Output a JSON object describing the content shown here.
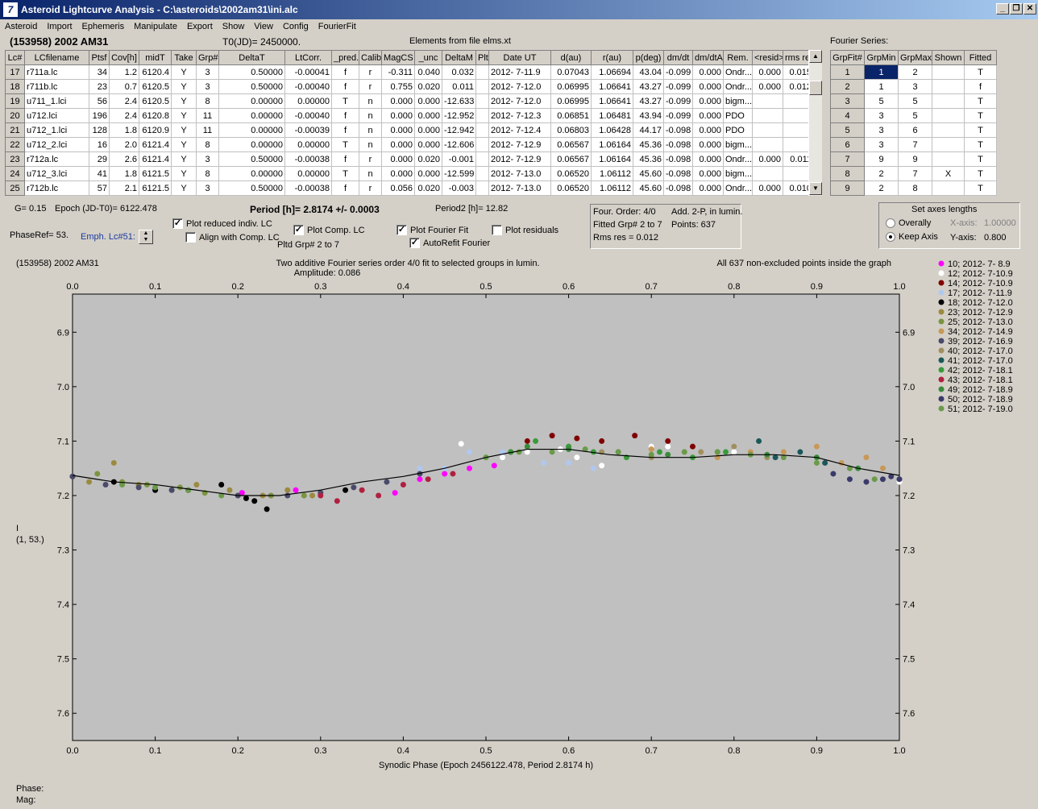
{
  "window": {
    "title": "Asteroid Lightcurve Analysis - C:\\asteroids\\2002am31\\ini.alc",
    "app_icon": "7"
  },
  "menu": [
    "Asteroid",
    "Import",
    "Ephemeris",
    "Manipulate",
    "Export",
    "Show",
    "View",
    "Config",
    "FourierFit"
  ],
  "header": {
    "object": "(153958) 2002 AM31",
    "t0": "T0(JD)= 2450000.",
    "elements": "Elements from file elms.xt",
    "fourier_series": "Fourier Series:"
  },
  "lc_table": {
    "columns": [
      "Lc#",
      "LCfilename",
      "Ptsf",
      "Cov[h]",
      "midT",
      "Take",
      "Grp#",
      "DeltaT",
      "LtCorr.",
      "_pred.",
      "Calib.",
      "MagCS",
      "_unc",
      "DeltaM",
      "Plt",
      "Date UT",
      "d(au)",
      "r(au)",
      "p(deg)",
      "dm/dt",
      "dm/dtA",
      "Rem.",
      "<resid>",
      "rms res"
    ],
    "rows": [
      [
        "17",
        "r711a.lc",
        "34",
        "1.2",
        "6120.4",
        "Y",
        "3",
        "0.50000",
        "-0.00041",
        "f",
        "r",
        "-0.311",
        "0.040",
        "0.032",
        "",
        "2012- 7-11.9",
        "0.07043",
        "1.06694",
        "43.04",
        "-0.099",
        "0.000",
        "Ondr...",
        "0.000",
        "0.015"
      ],
      [
        "18",
        "r711b.lc",
        "23",
        "0.7",
        "6120.5",
        "Y",
        "3",
        "0.50000",
        "-0.00040",
        "f",
        "r",
        "0.755",
        "0.020",
        "0.011",
        "",
        "2012- 7-12.0",
        "0.06995",
        "1.06641",
        "43.27",
        "-0.099",
        "0.000",
        "Ondr...",
        "0.000",
        "0.012"
      ],
      [
        "19",
        "u711_1.lci",
        "56",
        "2.4",
        "6120.5",
        "Y",
        "8",
        "0.00000",
        "0.00000",
        "T",
        "n",
        "0.000",
        "0.000",
        "-12.633",
        "",
        "2012- 7-12.0",
        "0.06995",
        "1.06641",
        "43.27",
        "-0.099",
        "0.000",
        "bigm...",
        "",
        ""
      ],
      [
        "20",
        "u712.lci",
        "196",
        "2.4",
        "6120.8",
        "Y",
        "11",
        "0.00000",
        "-0.00040",
        "f",
        "n",
        "0.000",
        "0.000",
        "-12.952",
        "",
        "2012- 7-12.3",
        "0.06851",
        "1.06481",
        "43.94",
        "-0.099",
        "0.000",
        "PDO",
        "",
        ""
      ],
      [
        "21",
        "u712_1.lci",
        "128",
        "1.8",
        "6120.9",
        "Y",
        "11",
        "0.00000",
        "-0.00039",
        "f",
        "n",
        "0.000",
        "0.000",
        "-12.942",
        "",
        "2012- 7-12.4",
        "0.06803",
        "1.06428",
        "44.17",
        "-0.098",
        "0.000",
        "PDO",
        "",
        ""
      ],
      [
        "22",
        "u712_2.lci",
        "16",
        "2.0",
        "6121.4",
        "Y",
        "8",
        "0.00000",
        "0.00000",
        "T",
        "n",
        "0.000",
        "0.000",
        "-12.606",
        "",
        "2012- 7-12.9",
        "0.06567",
        "1.06164",
        "45.36",
        "-0.098",
        "0.000",
        "bigm...",
        "",
        ""
      ],
      [
        "23",
        "r712a.lc",
        "29",
        "2.6",
        "6121.4",
        "Y",
        "3",
        "0.50000",
        "-0.00038",
        "f",
        "r",
        "0.000",
        "0.020",
        "-0.001",
        "",
        "2012- 7-12.9",
        "0.06567",
        "1.06164",
        "45.36",
        "-0.098",
        "0.000",
        "Ondr...",
        "0.000",
        "0.011"
      ],
      [
        "24",
        "u712_3.lci",
        "41",
        "1.8",
        "6121.5",
        "Y",
        "8",
        "0.00000",
        "0.00000",
        "T",
        "n",
        "0.000",
        "0.000",
        "-12.599",
        "",
        "2012- 7-13.0",
        "0.06520",
        "1.06112",
        "45.60",
        "-0.098",
        "0.000",
        "bigm...",
        "",
        ""
      ],
      [
        "25",
        "r712b.lc",
        "57",
        "2.1",
        "6121.5",
        "Y",
        "3",
        "0.50000",
        "-0.00038",
        "f",
        "r",
        "0.056",
        "0.020",
        "-0.003",
        "",
        "2012- 7-13.0",
        "0.06520",
        "1.06112",
        "45.60",
        "-0.098",
        "0.000",
        "Ondr...",
        "0.000",
        "0.010"
      ]
    ]
  },
  "fourier_table": {
    "columns": [
      "GrpFit#",
      "GrpMin",
      "GrpMax",
      "Shown",
      "Fitted"
    ],
    "rows": [
      [
        "1",
        "1",
        "2",
        "",
        "T"
      ],
      [
        "2",
        "1",
        "3",
        "",
        "f"
      ],
      [
        "3",
        "5",
        "5",
        "",
        "T"
      ],
      [
        "4",
        "3",
        "5",
        "",
        "T"
      ],
      [
        "5",
        "3",
        "6",
        "",
        "T"
      ],
      [
        "6",
        "3",
        "7",
        "",
        "T"
      ],
      [
        "7",
        "9",
        "9",
        "",
        "T"
      ],
      [
        "8",
        "2",
        "7",
        "X",
        "T"
      ],
      [
        "9",
        "2",
        "8",
        "",
        "T"
      ]
    ]
  },
  "controls": {
    "g": "G= 0.15",
    "epoch": "Epoch (JD-T0)= 6122.478",
    "period": "Period [h]= 2.8174 +/- 0.0003",
    "period2": "Period2 [h]= 12.82",
    "phaseref": "PhaseRef= 53.",
    "emph": "Emph. Lc#51:",
    "plot_reduced": "Plot reduced indiv. LC",
    "align_comp": "Align with Comp. LC",
    "plot_comp": "Plot Comp. LC",
    "plot_fourier": "Plot Fourier Fit",
    "autorefit": "AutoRefit Fourier",
    "plot_residuals": "Plot residuals",
    "pltd_grp": "Pltd Grp#  2   to   7",
    "info_order": "Four. Order:  4/0",
    "info_add": "Add. 2-P, in lumin.",
    "info_fitted": "Fitted Grp# 2 to 7",
    "info_points": "Points: 637",
    "info_rms": "Rms res     = 0.012",
    "axes_title": "Set axes lengths",
    "overally": "Overally",
    "keep_axis": "Keep Axis",
    "xaxis_label": "X-axis:",
    "xaxis_val": "1.00000",
    "yaxis_label": "Y-axis:",
    "yaxis_val": "0.800"
  },
  "plot": {
    "object": "(153958) 2002 AM31",
    "title": "Two additive Fourier series order 4/0 fit to selected groups in lumin.",
    "amplitude": "Amplitude: 0.086",
    "points_note": "All 637 non-excluded points inside the graph",
    "xlabel": "Synodic Phase (Epoch 2456122.478, Period 2.8174 h)",
    "ylabel_1": "I",
    "ylabel_2": "(1, 53.)",
    "phase_label": "Phase:",
    "mag_label": "Mag:"
  },
  "chart_data": {
    "type": "scatter",
    "xlabel": "Synodic Phase (Epoch 2456122.478, Period 2.8174 h)",
    "ylabel": "I",
    "xlim": [
      0.0,
      1.0
    ],
    "ylim": [
      7.65,
      6.83
    ],
    "y_inverted": true,
    "xticks": [
      "0.0",
      "0.1",
      "0.2",
      "0.3",
      "0.4",
      "0.5",
      "0.6",
      "0.7",
      "0.8",
      "0.9",
      "1.0"
    ],
    "yticks": [
      "6.9",
      "7.0",
      "7.1",
      "7.2",
      "7.3",
      "7.4",
      "7.5",
      "7.6"
    ],
    "grid": false,
    "legend_position": "right",
    "series": [
      {
        "name": "10; 2012- 7- 8.9",
        "color": "#ff00ff",
        "x": [
          0.205,
          0.24,
          0.27,
          0.39,
          0.42,
          0.45,
          0.48,
          0.51
        ],
        "y": [
          7.195,
          7.2,
          7.19,
          7.195,
          7.17,
          7.16,
          7.15,
          7.145
        ]
      },
      {
        "name": "12; 2012- 7-10.9",
        "color": "#ffffff",
        "x": [
          0.47,
          0.52,
          0.55,
          0.59,
          0.61,
          0.64,
          0.66,
          0.7,
          0.72,
          0.8,
          0.85,
          1.0
        ],
        "y": [
          7.105,
          7.13,
          7.12,
          7.115,
          7.13,
          7.145,
          7.12,
          7.11,
          7.11,
          7.12,
          7.13,
          7.175
        ]
      },
      {
        "name": "14; 2012- 7-10.9",
        "color": "#800000",
        "x": [
          0.53,
          0.55,
          0.58,
          0.61,
          0.64,
          0.68,
          0.72,
          0.75
        ],
        "y": [
          7.12,
          7.1,
          7.09,
          7.095,
          7.1,
          7.09,
          7.1,
          7.11
        ]
      },
      {
        "name": "17; 2012- 7-11.9",
        "color": "#b0c8f0",
        "x": [
          0.42,
          0.45,
          0.48,
          0.5,
          0.52,
          0.57,
          0.6,
          0.63
        ],
        "y": [
          7.15,
          7.15,
          7.12,
          7.13,
          7.12,
          7.14,
          7.14,
          7.15
        ]
      },
      {
        "name": "18; 2012- 7-12.0",
        "color": "#000000",
        "x": [
          0.0,
          0.05,
          0.1,
          0.14,
          0.18,
          0.21,
          0.22,
          0.235,
          0.33
        ],
        "y": [
          7.165,
          7.175,
          7.19,
          7.19,
          7.18,
          7.205,
          7.21,
          7.225,
          7.19
        ]
      },
      {
        "name": "23; 2012- 7-12.9",
        "color": "#9b8a40",
        "x": [
          0.02,
          0.05,
          0.08,
          0.12,
          0.15,
          0.19,
          0.23,
          0.26,
          0.29
        ],
        "y": [
          7.175,
          7.14,
          7.18,
          7.19,
          7.18,
          7.19,
          7.2,
          7.19,
          7.2
        ]
      },
      {
        "name": "25; 2012- 7-13.0",
        "color": "#7a9440",
        "x": [
          0.03,
          0.06,
          0.09,
          0.13,
          0.16,
          0.2,
          0.24,
          0.28
        ],
        "y": [
          7.16,
          7.175,
          7.18,
          7.185,
          7.195,
          7.2,
          7.2,
          7.2
        ]
      },
      {
        "name": "34; 2012- 7-14.9",
        "color": "#c89858",
        "x": [
          0.7,
          0.74,
          0.78,
          0.82,
          0.86,
          0.9,
          0.93,
          0.96,
          0.98
        ],
        "y": [
          7.115,
          7.12,
          7.13,
          7.12,
          7.12,
          7.11,
          7.14,
          7.13,
          7.15
        ]
      },
      {
        "name": "39; 2012- 7-16.9",
        "color": "#4a4a6a",
        "x": [
          0.0,
          0.04,
          0.08,
          0.12,
          0.2,
          0.26,
          0.3,
          0.34,
          0.38,
          0.42
        ],
        "y": [
          7.165,
          7.18,
          7.185,
          7.19,
          7.2,
          7.2,
          7.195,
          7.185,
          7.175,
          7.16
        ]
      },
      {
        "name": "40; 2012- 7-17.0",
        "color": "#a09060",
        "x": [
          0.6,
          0.64,
          0.7,
          0.76,
          0.8,
          0.84
        ],
        "y": [
          7.11,
          7.12,
          7.13,
          7.12,
          7.11,
          7.13
        ]
      },
      {
        "name": "41; 2012- 7-17.0",
        "color": "#1a5858",
        "x": [
          0.83,
          0.85,
          0.88,
          0.91
        ],
        "y": [
          7.1,
          7.13,
          7.12,
          7.14
        ]
      },
      {
        "name": "42; 2012- 7-18.1",
        "color": "#3a9a3a",
        "x": [
          0.5,
          0.53,
          0.56,
          0.6,
          0.63,
          0.67,
          0.71,
          0.75,
          0.79
        ],
        "y": [
          7.13,
          7.12,
          7.1,
          7.11,
          7.12,
          7.13,
          7.12,
          7.13,
          7.12
        ]
      },
      {
        "name": "43; 2012- 7-18.1",
        "color": "#b02040",
        "x": [
          0.3,
          0.32,
          0.35,
          0.37,
          0.4,
          0.43,
          0.46
        ],
        "y": [
          7.2,
          7.21,
          7.19,
          7.2,
          7.18,
          7.17,
          7.16
        ]
      },
      {
        "name": "49; 2012- 7-18.9",
        "color": "#3a8a3a",
        "x": [
          0.55,
          0.6,
          0.66,
          0.72,
          0.78,
          0.84,
          0.9,
          0.95
        ],
        "y": [
          7.11,
          7.115,
          7.12,
          7.125,
          7.12,
          7.125,
          7.13,
          7.15
        ]
      },
      {
        "name": "50; 2012- 7-18.9",
        "color": "#3a3a6a",
        "x": [
          0.92,
          0.94,
          0.96,
          0.98,
          0.99,
          1.0
        ],
        "y": [
          7.16,
          7.17,
          7.175,
          7.17,
          7.165,
          7.17
        ]
      },
      {
        "name": "51; 2012- 7-19.0",
        "color": "#6a9a4a",
        "x": [
          0.06,
          0.1,
          0.14,
          0.18,
          0.5,
          0.54,
          0.58,
          0.62,
          0.66,
          0.7,
          0.74,
          0.78,
          0.82,
          0.86,
          0.9,
          0.94,
          0.97
        ],
        "y": [
          7.18,
          7.185,
          7.19,
          7.2,
          7.13,
          7.12,
          7.12,
          7.115,
          7.12,
          7.125,
          7.12,
          7.12,
          7.125,
          7.13,
          7.14,
          7.15,
          7.17
        ]
      }
    ],
    "fit_curve": {
      "x": [
        0.0,
        0.05,
        0.1,
        0.15,
        0.2,
        0.25,
        0.3,
        0.35,
        0.4,
        0.45,
        0.5,
        0.55,
        0.6,
        0.65,
        0.7,
        0.75,
        0.8,
        0.85,
        0.9,
        0.95,
        1.0
      ],
      "y": [
        7.163,
        7.175,
        7.18,
        7.19,
        7.2,
        7.2,
        7.19,
        7.175,
        7.165,
        7.15,
        7.13,
        7.115,
        7.115,
        7.125,
        7.13,
        7.13,
        7.125,
        7.125,
        7.13,
        7.15,
        7.163
      ]
    }
  }
}
